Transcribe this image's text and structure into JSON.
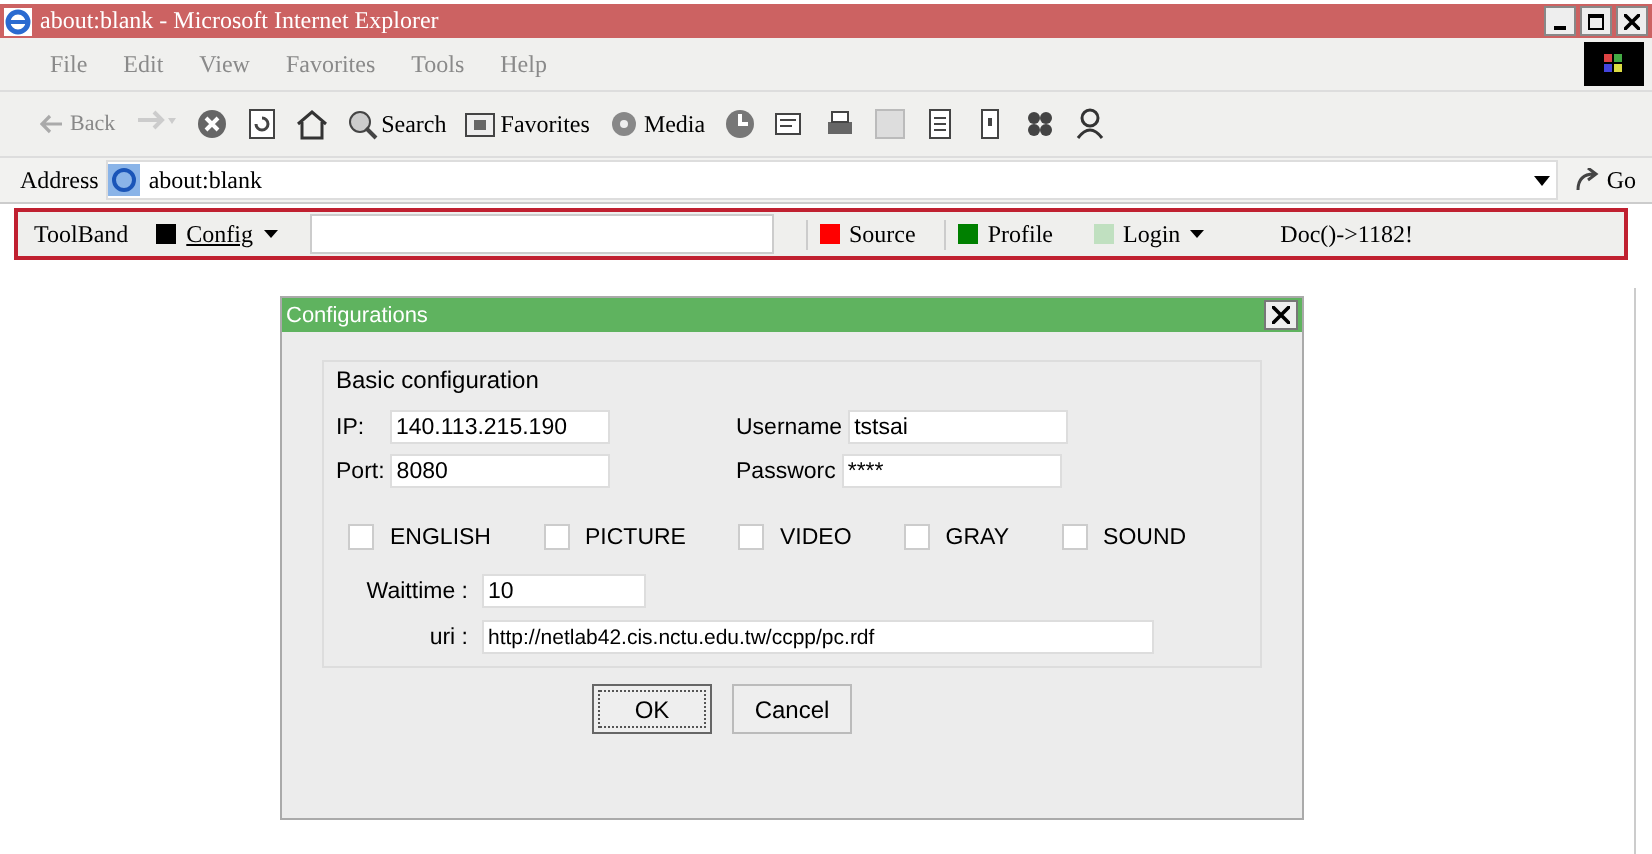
{
  "window": {
    "title": "about:blank - Microsoft Internet Explorer"
  },
  "menu": [
    "File",
    "Edit",
    "View",
    "Favorites",
    "Tools",
    "Help"
  ],
  "toolbar": {
    "back": "Back",
    "buttons": [
      {
        "kind": "icon"
      },
      {
        "kind": "icon"
      },
      {
        "kind": "icon"
      },
      {
        "kind": "text",
        "label": "Search"
      },
      {
        "kind": "text",
        "label": "Favorites"
      },
      {
        "kind": "text",
        "label": "Media"
      },
      {
        "kind": "icon"
      },
      {
        "kind": "icon"
      },
      {
        "kind": "icon"
      },
      {
        "kind": "icon"
      },
      {
        "kind": "icon"
      },
      {
        "kind": "icon"
      },
      {
        "kind": "icon"
      },
      {
        "kind": "icon"
      }
    ]
  },
  "address": {
    "label": "Address",
    "value": "about:blank",
    "go": "Go"
  },
  "toolband": {
    "label": "ToolBand",
    "items": [
      {
        "kind": "menu",
        "color": "#000000",
        "label": "Config"
      },
      {
        "kind": "field"
      },
      {
        "kind": "button",
        "color": "#ff0000",
        "label": "Source"
      },
      {
        "kind": "button",
        "color": "#008000",
        "label": "Profile"
      },
      {
        "kind": "menu",
        "color": "#c0e0c0",
        "label": "Login"
      },
      {
        "kind": "text",
        "label": "Doc()->1182!"
      }
    ]
  },
  "dialog": {
    "title": "Configurations",
    "group": "Basic configuration",
    "fields": [
      {
        "label": "IP:",
        "value": "140.113.215.190"
      },
      {
        "label": "Username",
        "value": "tstsai"
      },
      {
        "label": "Port:",
        "value": "8080"
      },
      {
        "label": "Passworc",
        "value": "****"
      }
    ],
    "options": [
      {
        "label": "ENGLISH",
        "checked": false
      },
      {
        "label": "PICTURE",
        "checked": false
      },
      {
        "label": "VIDEO",
        "checked": false
      },
      {
        "label": "GRAY",
        "checked": false
      },
      {
        "label": "SOUND",
        "checked": false
      }
    ],
    "waittime": {
      "label": "Waittime :",
      "value": "10"
    },
    "uri": {
      "label": "uri :",
      "value": "http://netlab42.cis.nctu.edu.tw/ccpp/pc.rdf"
    },
    "buttons": [
      {
        "label": "OK",
        "selected": true
      },
      {
        "label": "Cancel",
        "selected": false
      }
    ]
  }
}
